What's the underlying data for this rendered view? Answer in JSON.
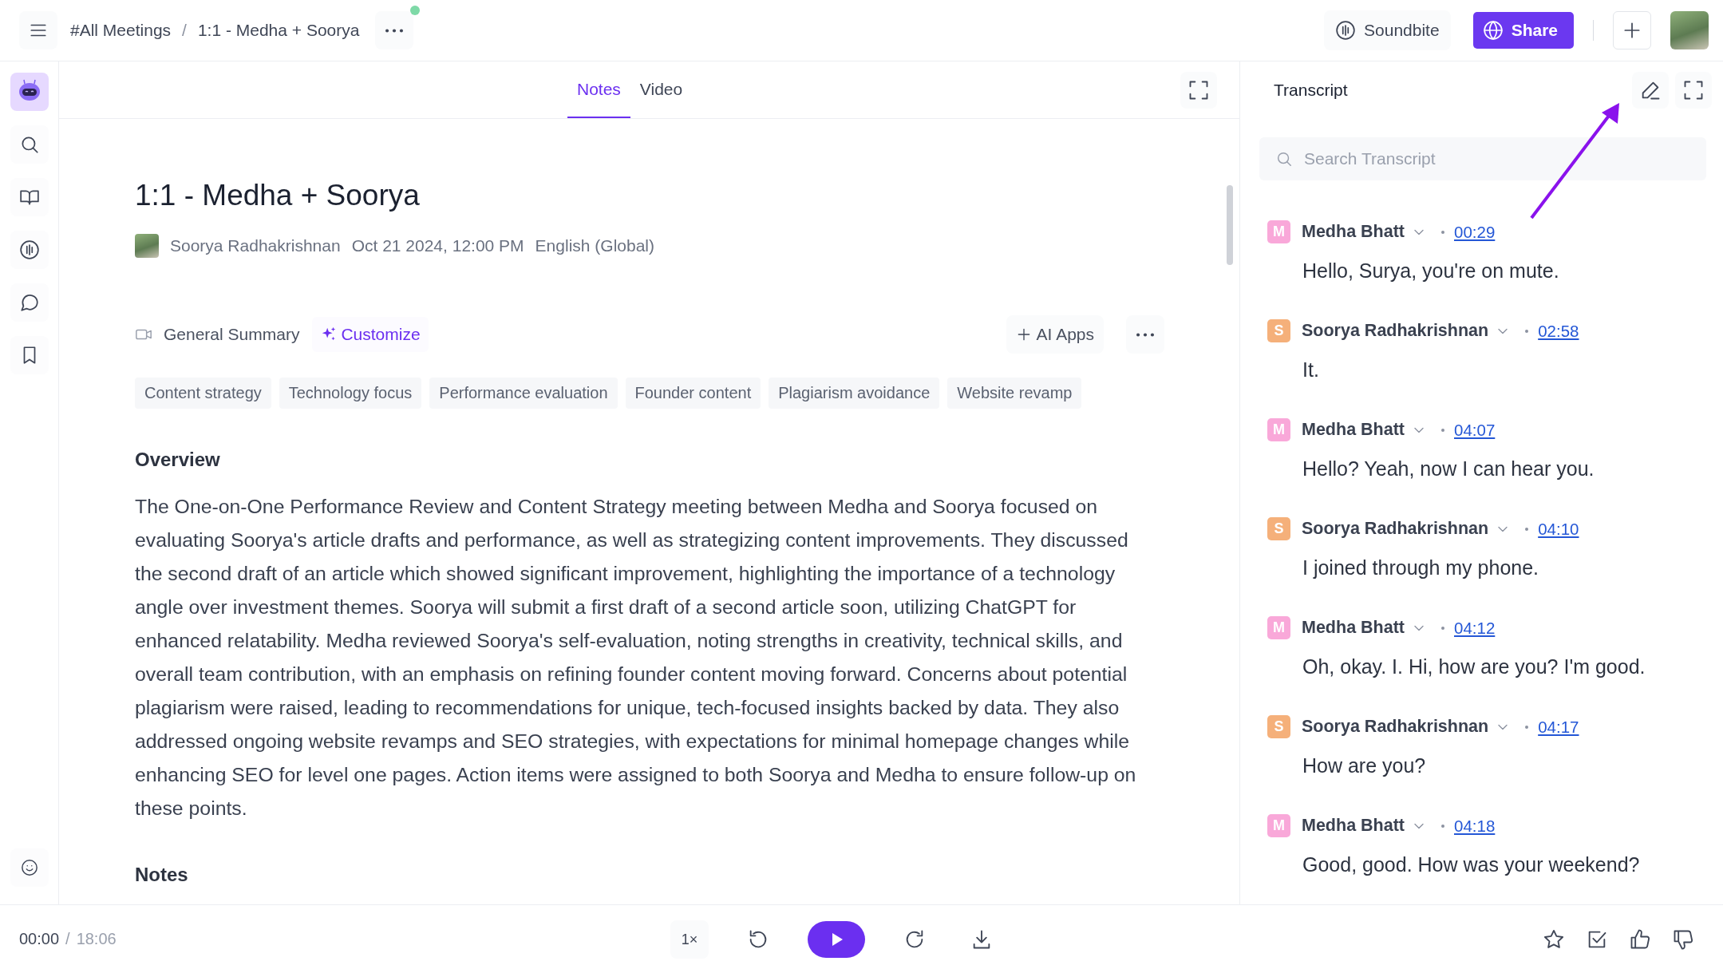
{
  "top_bar": {
    "breadcrumb": [
      "#All Meetings",
      "1:1 - Medha + Soorya"
    ],
    "separator": "/",
    "notification": true,
    "soundbite": "Soundbite",
    "share": "Share"
  },
  "tabs": [
    {
      "label": "Notes",
      "selected": true
    },
    {
      "label": "Video",
      "selected": false
    }
  ],
  "note": {
    "title": "1:1 - Medha + Soorya",
    "author": "Soorya Radhakrishnan",
    "date": "Oct 21 2024, 12:00 PM",
    "language": "English (Global)",
    "template": "General Summary",
    "customize": "Customize",
    "ai_apps": "AI Apps",
    "tags": [
      "Content strategy",
      "Technology focus",
      "Performance evaluation",
      "Founder content",
      "Plagiarism avoidance",
      "Website revamp"
    ],
    "overview_heading": "Overview",
    "overview": "The One-on-One Performance Review and Content Strategy meeting between Medha and Soorya focused on evaluating Soorya's article drafts and performance, as well as strategizing content improvements. They discussed the second draft of an article which showed significant improvement, highlighting the importance of a technology angle over investment themes. Soorya will submit a first draft of a second article soon, utilizing ChatGPT for enhanced relatability. Medha reviewed Soorya's self-evaluation, noting strengths in creativity, technical skills, and overall team contribution, with an emphasis on refining founder content moving forward. Concerns about potential plagiarism were raised, leading to recommendations for unique, tech-focused insights backed by data. They also addressed ongoing website revamps and SEO strategies, with expectations for minimal homepage changes while enhancing SEO for level one pages. Action items were assigned to both Soorya and Medha to ensure follow-up on these points.",
    "notes_heading": "Notes"
  },
  "transcript": {
    "title": "Transcript",
    "search_placeholder": "Search Transcript",
    "entries": [
      {
        "initial": "M",
        "color": "#f9a8d9",
        "speaker": "Medha Bhatt",
        "time": "00:29",
        "text": "Hello, Surya, you're on mute."
      },
      {
        "initial": "S",
        "color": "#f5b07a",
        "speaker": "Soorya Radhakrishnan",
        "time": "02:58",
        "text": "It."
      },
      {
        "initial": "M",
        "color": "#f9a8d9",
        "speaker": "Medha Bhatt",
        "time": "04:07",
        "text": "Hello? Yeah, now I can hear you."
      },
      {
        "initial": "S",
        "color": "#f5b07a",
        "speaker": "Soorya Radhakrishnan",
        "time": "04:10",
        "text": "I joined through my phone."
      },
      {
        "initial": "M",
        "color": "#f9a8d9",
        "speaker": "Medha Bhatt",
        "time": "04:12",
        "text": "Oh, okay. I. Hi, how are you? I'm good."
      },
      {
        "initial": "S",
        "color": "#f5b07a",
        "speaker": "Soorya Radhakrishnan",
        "time": "04:17",
        "text": "How are you?"
      },
      {
        "initial": "M",
        "color": "#f9a8d9",
        "speaker": "Medha Bhatt",
        "time": "04:18",
        "text": "Good, good. How was your weekend?"
      }
    ]
  },
  "player": {
    "current": "00:00",
    "separator": "/",
    "total": "18:06",
    "speed": "1×"
  }
}
